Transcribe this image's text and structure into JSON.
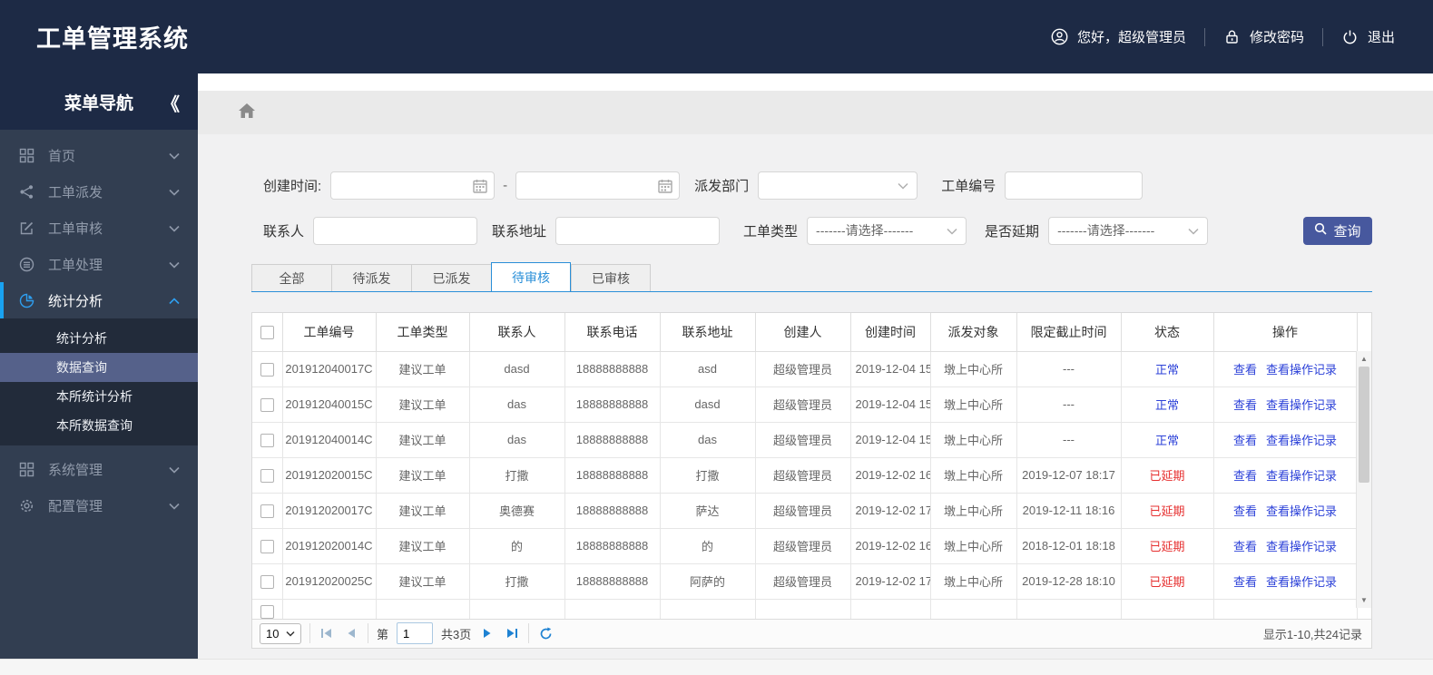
{
  "header": {
    "title": "工单管理系统",
    "greeting": "您好，超级管理员",
    "change_password": "修改密码",
    "logout": "退出"
  },
  "sidebar": {
    "title": "菜单导航",
    "collapse_icon": "《",
    "items": [
      {
        "label": "首页",
        "icon": "grid-icon"
      },
      {
        "label": "工单派发",
        "icon": "share-icon"
      },
      {
        "label": "工单审核",
        "icon": "edit-icon"
      },
      {
        "label": "工单处理",
        "icon": "process-icon"
      },
      {
        "label": "统计分析",
        "icon": "pie-chart-icon",
        "active": true
      },
      {
        "label": "系统管理",
        "icon": "grid-icon"
      },
      {
        "label": "配置管理",
        "icon": "gear-icon"
      }
    ],
    "submenu": {
      "items": [
        "统计分析",
        "数据查询",
        "本所统计分析",
        "本所数据查询"
      ],
      "active": "数据查询"
    }
  },
  "filters": {
    "create_time_label": "创建时间:",
    "range_separator": "-",
    "dispatch_dept_label": "派发部门",
    "order_no_label": "工单编号",
    "contact_label": "联系人",
    "address_label": "联系地址",
    "order_type_label": "工单类型",
    "delay_label": "是否延期",
    "select_placeholder": "-------请选择-------",
    "search_button": "查询"
  },
  "tabs": [
    {
      "label": "全部"
    },
    {
      "label": "待派发"
    },
    {
      "label": "已派发"
    },
    {
      "label": "待审核",
      "active": true
    },
    {
      "label": "已审核"
    }
  ],
  "table": {
    "columns": [
      "工单编号",
      "工单类型",
      "联系人",
      "联系电话",
      "联系地址",
      "创建人",
      "创建时间",
      "派发对象",
      "限定截止时间",
      "状态",
      "操作"
    ],
    "labels": {
      "view": "查看",
      "view_log": "查看操作记录"
    },
    "status_colors": {
      "normal": "#2c41d8",
      "delayed": "#e62f2f"
    },
    "rows": [
      {
        "no": "201912040017C",
        "type": "建议工单",
        "contact": "dasd",
        "phone": "18888888888",
        "addr": "asd",
        "creator": "超级管理员",
        "created": "2019-12-04 15",
        "dispatch": "墩上中心所",
        "deadline": "---",
        "status": "正常",
        "status_color": "#2c41d8"
      },
      {
        "no": "201912040015C",
        "type": "建议工单",
        "contact": "das",
        "phone": "18888888888",
        "addr": "dasd",
        "creator": "超级管理员",
        "created": "2019-12-04 15",
        "dispatch": "墩上中心所",
        "deadline": "---",
        "status": "正常",
        "status_color": "#2c41d8"
      },
      {
        "no": "201912040014C",
        "type": "建议工单",
        "contact": "das",
        "phone": "18888888888",
        "addr": "das",
        "creator": "超级管理员",
        "created": "2019-12-04 15",
        "dispatch": "墩上中心所",
        "deadline": "---",
        "status": "正常",
        "status_color": "#2c41d8"
      },
      {
        "no": "201912020015C",
        "type": "建议工单",
        "contact": "打撒",
        "phone": "18888888888",
        "addr": "打撒",
        "creator": "超级管理员",
        "created": "2019-12-02 16",
        "dispatch": "墩上中心所",
        "deadline": "2019-12-07 18:17",
        "status": "已延期",
        "status_color": "#e62f2f"
      },
      {
        "no": "201912020017C",
        "type": "建议工单",
        "contact": "奥德赛",
        "phone": "18888888888",
        "addr": "萨达",
        "creator": "超级管理员",
        "created": "2019-12-02 17",
        "dispatch": "墩上中心所",
        "deadline": "2019-12-11 18:16",
        "status": "已延期",
        "status_color": "#e62f2f"
      },
      {
        "no": "201912020014C",
        "type": "建议工单",
        "contact": "的",
        "phone": "18888888888",
        "addr": "的",
        "creator": "超级管理员",
        "created": "2019-12-02 16",
        "dispatch": "墩上中心所",
        "deadline": "2018-12-01 18:18",
        "status": "已延期",
        "status_color": "#e62f2f"
      },
      {
        "no": "201912020025C",
        "type": "建议工单",
        "contact": "打撒",
        "phone": "18888888888",
        "addr": "阿萨的",
        "creator": "超级管理员",
        "created": "2019-12-02 17",
        "dispatch": "墩上中心所",
        "deadline": "2019-12-28 18:10",
        "status": "已延期",
        "status_color": "#e62f2f"
      }
    ]
  },
  "pagination": {
    "page_size": "10",
    "page_prefix": "第",
    "current_page": "1",
    "total_pages": "共3页",
    "summary": "显示1-10,共24记录"
  },
  "colors": {
    "topbar_bg": "#1d2a45",
    "sidebar_bg": "#323e51",
    "accent_blue": "#19a2f1",
    "tab_blue": "#2a8fd8",
    "button_bg": "#47589e",
    "link_blue": "#2c41d8",
    "status_red": "#e62f2f"
  }
}
